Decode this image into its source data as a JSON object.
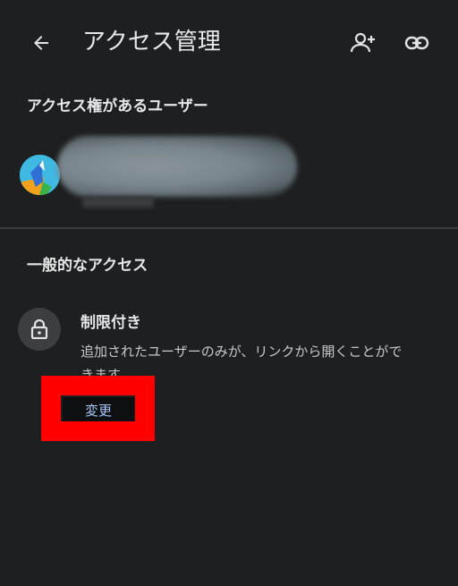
{
  "header": {
    "title": "アクセス管理",
    "back_icon": "arrow-back-icon",
    "add_person_icon": "person-add-icon",
    "link_icon": "link-icon"
  },
  "users_section": {
    "heading": "アクセス権があるユーザー",
    "user": {
      "avatar_icon": "avatar"
    }
  },
  "general_access": {
    "heading": "一般的なアクセス",
    "setting_title": "制限付き",
    "description": "追加されたユーザーのみが、リンクから開くことができます",
    "change_label": "変更",
    "icon": "lock-icon"
  },
  "colors": {
    "background": "#1e1f20",
    "link_text": "#a8c7fa",
    "highlight": "#ff0000"
  }
}
